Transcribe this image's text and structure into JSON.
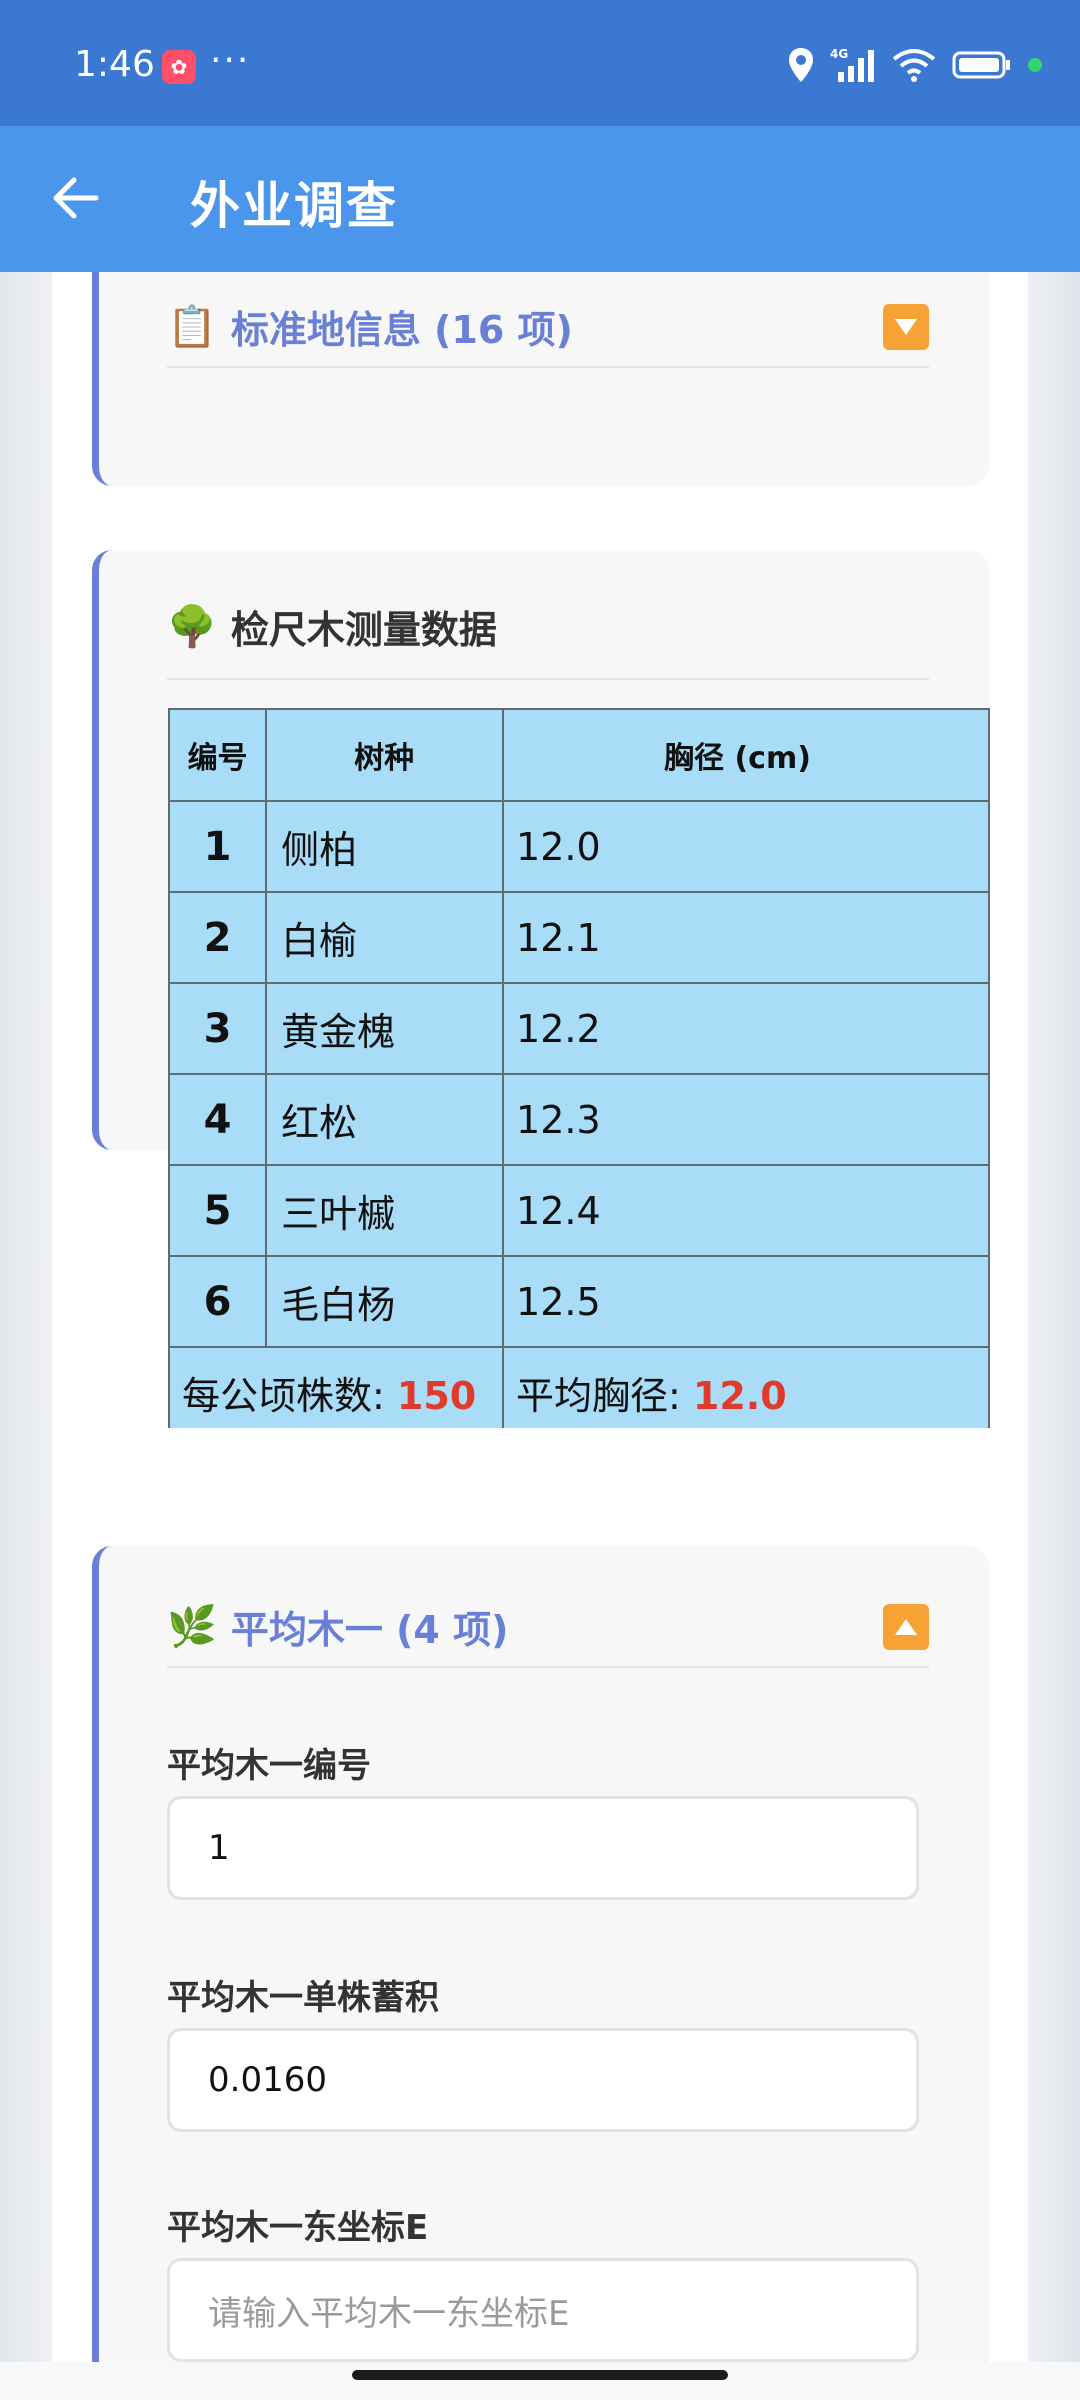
{
  "status_bar": {
    "time": "1:46",
    "dots": "···",
    "network": "4G"
  },
  "app_bar": {
    "title": "外业调查"
  },
  "sections": {
    "plot_info": {
      "emoji": "📋",
      "title": "标准地信息 (16 项)"
    },
    "sample_trees": {
      "emoji": "🌳",
      "title": "检尺木测量数据",
      "columns": [
        "编号",
        "树种",
        "胸径 (cm)"
      ],
      "rows": [
        {
          "no": "1",
          "species": "侧柏",
          "dbh": "12.0"
        },
        {
          "no": "2",
          "species": "白榆",
          "dbh": "12.1"
        },
        {
          "no": "3",
          "species": "黄金槐",
          "dbh": "12.2"
        },
        {
          "no": "4",
          "species": "红松",
          "dbh": "12.3"
        },
        {
          "no": "5",
          "species": "三叶槭",
          "dbh": "12.4"
        },
        {
          "no": "6",
          "species": "毛白杨",
          "dbh": "12.5"
        }
      ],
      "summary": {
        "per_hectare_label": "每公顷株数: ",
        "per_hectare_value": "150",
        "avg_dbh_label": "平均胸径: ",
        "avg_dbh_value": "12.0"
      }
    },
    "avg_tree_1": {
      "emoji": "🌿",
      "title": "平均木一 (4 项)",
      "fields": [
        {
          "label": "平均木一编号",
          "value": "1",
          "placeholder": ""
        },
        {
          "label": "平均木一单株蓄积",
          "value": "0.0160",
          "placeholder": ""
        },
        {
          "label": "平均木一东坐标E",
          "value": "",
          "placeholder": "请输入平均木一东坐标E"
        }
      ]
    }
  },
  "colors": {
    "status_bar": "#3a78d1",
    "app_bar": "#4a96ec",
    "accent": "#6b7fd8",
    "table_cell": "#a9dcf6",
    "highlight": "#e03a2a",
    "toggle": "#f7a234"
  }
}
